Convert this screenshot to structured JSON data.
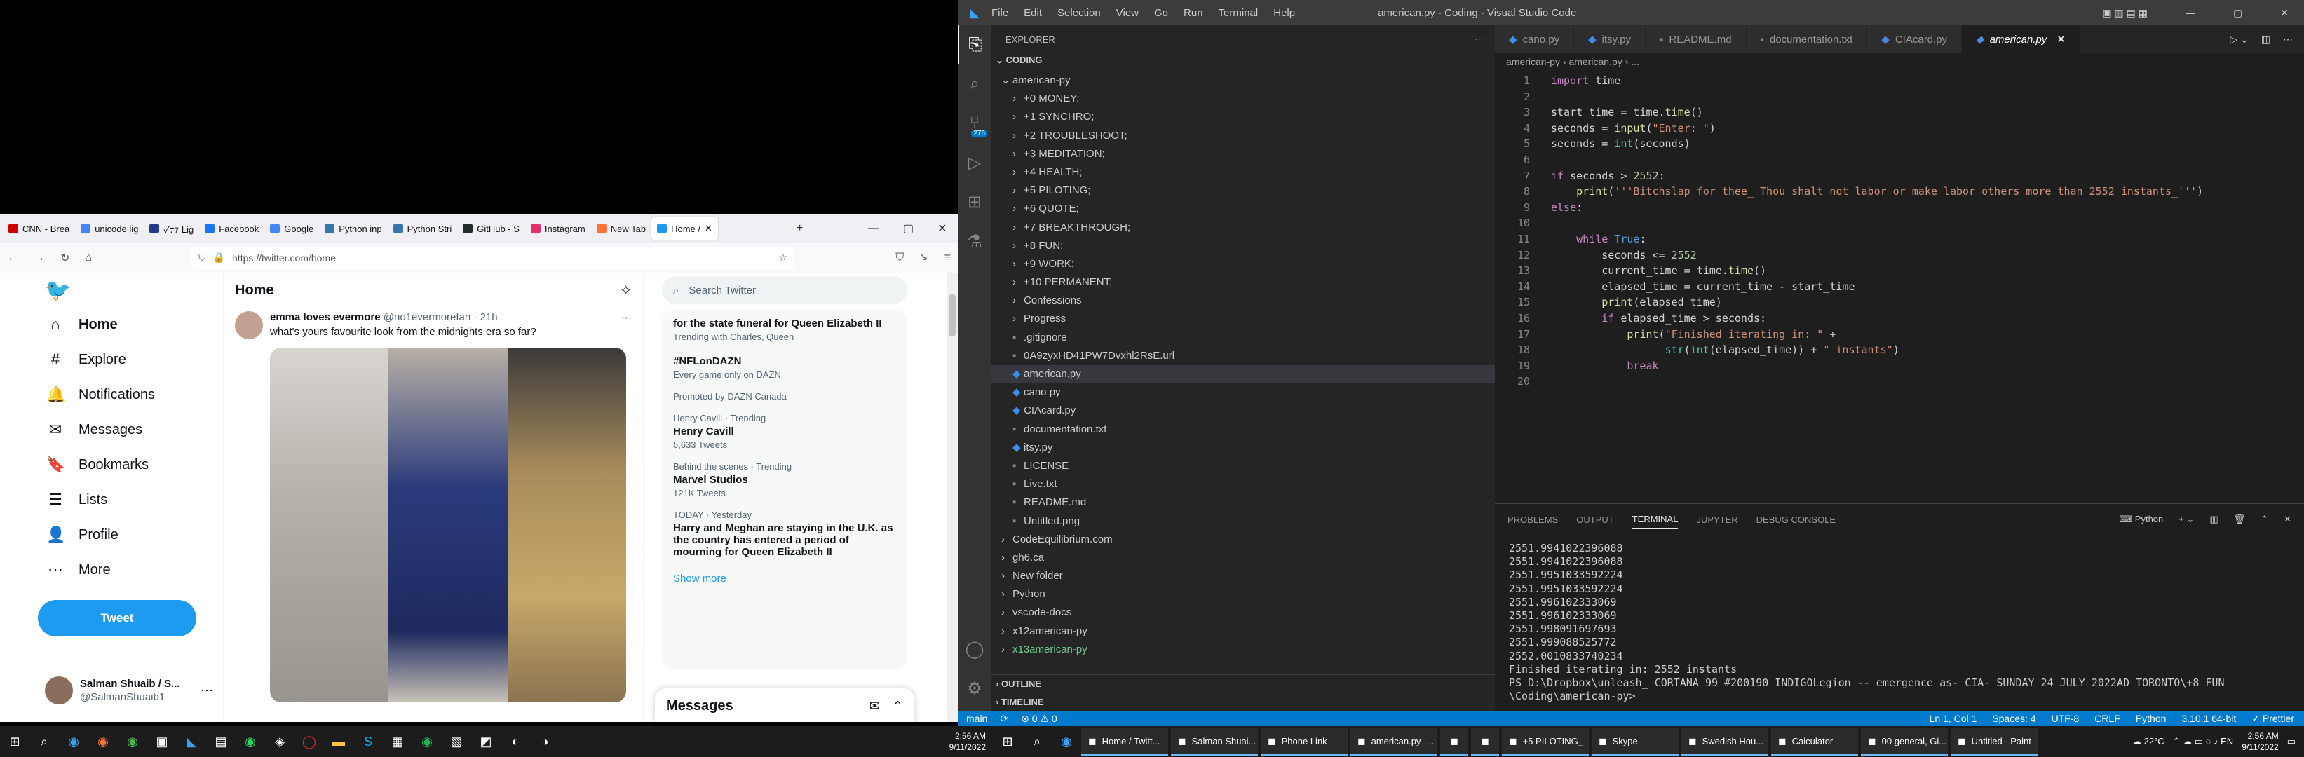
{
  "browser": {
    "tabs": [
      {
        "label": "CNN - Brea",
        "color": "#cc0000"
      },
      {
        "label": "unicode lig",
        "color": "#4285f4"
      },
      {
        "label": "✓ﾅｧ Lig",
        "color": "#1f3c8a"
      },
      {
        "label": "Facebook",
        "color": "#1877f2"
      },
      {
        "label": "Google",
        "color": "#4285f4"
      },
      {
        "label": "Python inp",
        "color": "#3776ab"
      },
      {
        "label": "Python Stri",
        "color": "#3776ab"
      },
      {
        "label": "GitHub - S",
        "color": "#24292f"
      },
      {
        "label": "Instagram",
        "color": "#e1306c"
      },
      {
        "label": "New Tab",
        "color": "#ff7139"
      },
      {
        "label": "Home /",
        "color": "#1d9bf0"
      }
    ],
    "url": "https://twitter.com/home"
  },
  "twitter": {
    "nav": [
      {
        "label": "Home",
        "icon": "home-icon",
        "glyph": "⌂"
      },
      {
        "label": "Explore",
        "icon": "hashtag-icon",
        "glyph": "#"
      },
      {
        "label": "Notifications",
        "icon": "bell-icon",
        "glyph": "🔔"
      },
      {
        "label": "Messages",
        "icon": "mail-icon",
        "glyph": "✉"
      },
      {
        "label": "Bookmarks",
        "icon": "bookmark-icon",
        "glyph": "🔖"
      },
      {
        "label": "Lists",
        "icon": "list-icon",
        "glyph": "☰"
      },
      {
        "label": "Profile",
        "icon": "person-icon",
        "glyph": "👤"
      },
      {
        "label": "More",
        "icon": "more-icon",
        "glyph": "⋯"
      }
    ],
    "tweet_button": "Tweet",
    "profile": {
      "name": "Salman Shuaib / S...",
      "handle": "@SalmanShuaib1"
    },
    "timeline_title": "Home",
    "tweet": {
      "name": "emma loves evermore",
      "handle": "@no1evermorefan · 21h",
      "text": "what's yours favourite look from the midnights era so far?"
    },
    "search_placeholder": "Search Twitter",
    "trends": [
      {
        "meta": "",
        "title": "for the state funeral for Queen Elizabeth II",
        "sub": "Trending with Charles, Queen"
      },
      {
        "meta": "",
        "title": "#NFLonDAZN",
        "sub": "Every game only on DAZN"
      },
      {
        "meta": "",
        "title": "",
        "sub": "Promoted by DAZN Canada"
      },
      {
        "meta": "Henry Cavill · Trending",
        "title": "Henry Cavill",
        "sub": "5,633 Tweets"
      },
      {
        "meta": "Behind the scenes · Trending",
        "title": "Marvel Studios",
        "sub": "121K Tweets"
      },
      {
        "meta": "TODAY · Yesterday",
        "title": "Harry and Meghan are staying in the U.K. as the country has entered a period of mourning for Queen Elizabeth II",
        "sub": ""
      }
    ],
    "show_more": "Show more",
    "messages": "Messages"
  },
  "vscode": {
    "menu": [
      "File",
      "Edit",
      "Selection",
      "View",
      "Go",
      "Run",
      "Terminal",
      "Help"
    ],
    "title": "american.py - Coding - Visual Studio Code",
    "explorer_title": "EXPLORER",
    "workspace": "CODING",
    "tree": [
      {
        "t": "american-py",
        "d": 1,
        "k": "folder-open"
      },
      {
        "t": "+0 MONEY;",
        "d": 2,
        "k": "folder"
      },
      {
        "t": "+1 SYNCHRO;",
        "d": 2,
        "k": "folder"
      },
      {
        "t": "+2 TROUBLESHOOT;",
        "d": 2,
        "k": "folder"
      },
      {
        "t": "+3 MEDITATION;",
        "d": 2,
        "k": "folder"
      },
      {
        "t": "+4 HEALTH;",
        "d": 2,
        "k": "folder"
      },
      {
        "t": "+5 PILOTING;",
        "d": 2,
        "k": "folder"
      },
      {
        "t": "+6 QUOTE;",
        "d": 2,
        "k": "folder"
      },
      {
        "t": "+7 BREAKTHROUGH;",
        "d": 2,
        "k": "folder"
      },
      {
        "t": "+8 FUN;",
        "d": 2,
        "k": "folder"
      },
      {
        "t": "+9 WORK;",
        "d": 2,
        "k": "folder"
      },
      {
        "t": "+10 PERMANENT;",
        "d": 2,
        "k": "folder"
      },
      {
        "t": "Confessions",
        "d": 2,
        "k": "folder"
      },
      {
        "t": "Progress",
        "d": 2,
        "k": "folder"
      },
      {
        "t": ".gitignore",
        "d": 2,
        "k": "file"
      },
      {
        "t": "0A9zyxHD41PW7Dvxhl2RsE.url",
        "d": 2,
        "k": "file"
      },
      {
        "t": "american.py",
        "d": 2,
        "k": "py",
        "sel": true
      },
      {
        "t": "cano.py",
        "d": 2,
        "k": "py"
      },
      {
        "t": "CIAcard.py",
        "d": 2,
        "k": "py"
      },
      {
        "t": "documentation.txt",
        "d": 2,
        "k": "file"
      },
      {
        "t": "itsy.py",
        "d": 2,
        "k": "py"
      },
      {
        "t": "LICENSE",
        "d": 2,
        "k": "file"
      },
      {
        "t": "Live.txt",
        "d": 2,
        "k": "file"
      },
      {
        "t": "README.md",
        "d": 2,
        "k": "file"
      },
      {
        "t": "Untitled.png",
        "d": 2,
        "k": "file"
      },
      {
        "t": "CodeEquilibrium.com",
        "d": 1,
        "k": "folder"
      },
      {
        "t": "gh6.ca",
        "d": 1,
        "k": "folder"
      },
      {
        "t": "New folder",
        "d": 1,
        "k": "folder"
      },
      {
        "t": "Python",
        "d": 1,
        "k": "folder"
      },
      {
        "t": "vscode-docs",
        "d": 1,
        "k": "folder"
      },
      {
        "t": "x12american-py",
        "d": 1,
        "k": "folder"
      },
      {
        "t": "x13american-py",
        "d": 1,
        "k": "folder",
        "green": true
      }
    ],
    "outline": "OUTLINE",
    "timeline": "TIMELINE",
    "editor_tabs": [
      "cano.py",
      "itsy.py",
      "README.md",
      "documentation.txt",
      "CIAcard.py",
      "american.py"
    ],
    "breadcrumb": "american-py  ›  american.py  › ...",
    "code": [
      "<span class='kw'>import</span> time",
      "",
      "start_time = time.<span class='fn'>time</span>()",
      "seconds = <span class='fn'>input</span>(<span class='st'>\"Enter: \"</span>)",
      "seconds = <span class='bi'>int</span>(seconds)",
      "",
      "<span class='kw'>if</span> seconds &gt; <span class='nm'>2552</span>:",
      "    <span class='fn'>print</span>(<span class='st'>'''Bitchslap for thee_ Thou shalt not labor or make labor others more than 2552 instants_'''</span>)",
      "<span class='kw'>else</span>:",
      "",
      "    <span class='kw'>while</span> <span class='kb'>True</span>:",
      "        seconds &lt;= <span class='nm'>2552</span>",
      "        current_time = time.<span class='fn'>time</span>()",
      "        elapsed_time = current_time - start_time",
      "        <span class='fn'>print</span>(elapsed_time)",
      "        <span class='kw'>if</span> elapsed_time &gt; seconds:",
      "            <span class='fn'>print</span>(<span class='st'>\"Finished iterating in: \"</span> +",
      "                  <span class='bi'>str</span>(<span class='bi'>int</span>(elapsed_time)) + <span class='st'>\" instants\"</span>)",
      "            <span class='kw'>break</span>",
      ""
    ],
    "panel_tabs": [
      "PROBLEMS",
      "OUTPUT",
      "TERMINAL",
      "JUPYTER",
      "DEBUG CONSOLE"
    ],
    "panel_lang": "Python",
    "terminal": [
      "2551.9941022396088",
      "2551.9941022396088",
      "2551.9951033592224",
      "2551.9951033592224",
      "2551.996102333069",
      "2551.996102333069",
      "2551.998091697693",
      "2551.999088525772",
      "2552.0010833740234",
      "Finished iterating in: 2552 instants",
      "PS D:\\Dropbox\\unleash_ CORTANA 99 #200190 INDIGOLegion -- emergence as- CIA- SUNDAY 24 JULY 2022AD TORONTO\\+8 FUN",
      "\\Coding\\american-py> "
    ],
    "status_left": [
      "main",
      "⟳",
      "⊗ 0 ⚠ 0"
    ],
    "status_right": [
      "Ln 1, Col 1",
      "Spaces: 4",
      "UTF-8",
      "CRLF",
      "Python",
      "3.10.1 64-bit",
      "✓ Prettier"
    ],
    "scm_badge": "276"
  },
  "taskbar": {
    "left_time": "2:56 AM",
    "left_date": "9/11/2022",
    "right_apps": [
      "Home / Twitt...",
      "Salman Shuai...",
      "Phone Link",
      "american.py -...",
      "",
      "",
      "+5 PILOTING_",
      "Skype",
      "Swedish Hou...",
      "Calculator",
      "00 general, Gi...",
      "Untitled - Paint"
    ],
    "temp": "22°C",
    "right_time": "2:56 AM",
    "right_date": "9/11/2022"
  }
}
